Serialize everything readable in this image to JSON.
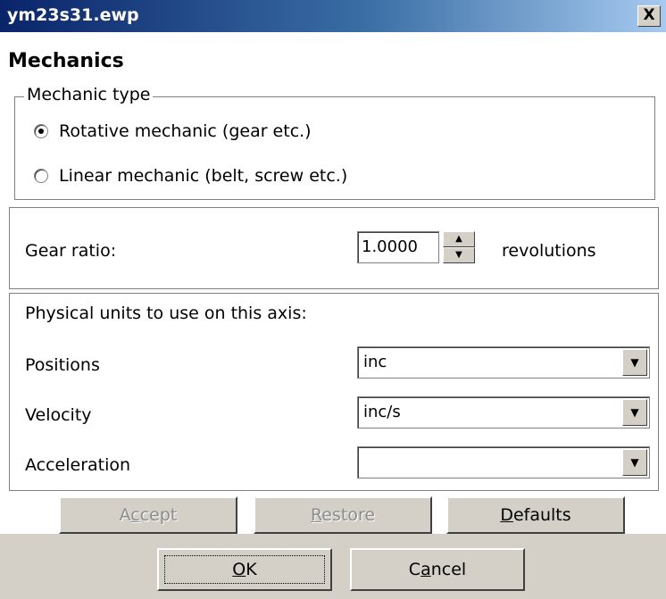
{
  "window": {
    "title": "ym23s31.ewp",
    "close_glyph": "X"
  },
  "header": {
    "title": "Mechanics"
  },
  "mechanic_type": {
    "legend": "Mechanic type",
    "options": [
      {
        "label": "Rotative mechanic (gear etc.)",
        "selected": true
      },
      {
        "label": "Linear mechanic (belt, screw etc.)",
        "selected": false
      }
    ]
  },
  "gear": {
    "label": "Gear ratio:",
    "value": "1.0000",
    "unit": "revolutions"
  },
  "units": {
    "heading": "Physical units to use on this axis:",
    "fields": [
      {
        "label": "Positions",
        "value": "inc"
      },
      {
        "label": "Velocity",
        "value": "inc/s"
      },
      {
        "label": "Acceleration",
        "value": ""
      }
    ]
  },
  "actions": {
    "accept": {
      "pre": "A",
      "key": "c",
      "post": "cept"
    },
    "restore": {
      "pre": "",
      "key": "R",
      "post": "estore"
    },
    "defaults": {
      "pre": "",
      "key": "D",
      "post": "efaults"
    }
  },
  "footer": {
    "ok": {
      "pre": "",
      "key": "O",
      "post": "K"
    },
    "cancel": {
      "pre": "C",
      "key": "a",
      "post": "ncel"
    }
  },
  "colors": {
    "titlebar_start": "#0a246a",
    "face": "#d4d0c8",
    "disabled_text": "#8c8c8c"
  }
}
